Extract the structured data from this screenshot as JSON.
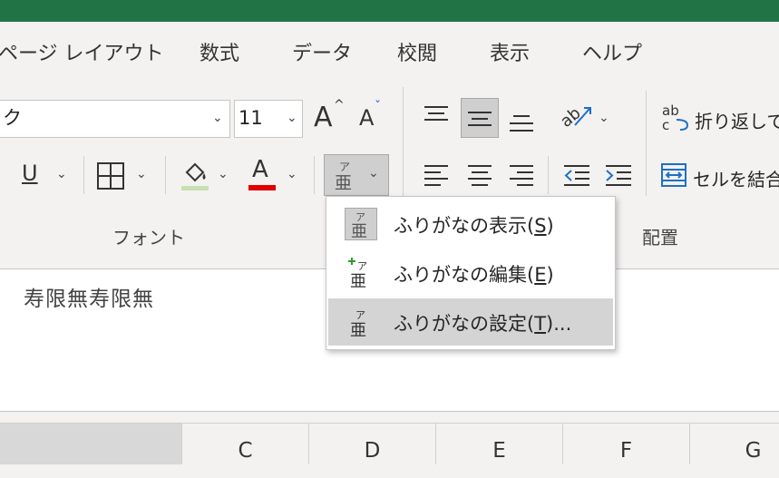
{
  "colors": {
    "title_bar": "#217346",
    "font_color_underline": "#e00000",
    "highlight_underline": "#c6e0b4",
    "hover_bg": "#d4d4d4"
  },
  "menu": {
    "tabs": [
      "ページ レイアウト",
      "数式",
      "データ",
      "校閲",
      "表示",
      "ヘルプ"
    ]
  },
  "font_group": {
    "font_name": "ク",
    "font_size": "11",
    "grow_icon_label": "A",
    "shrink_icon_label": "A",
    "underline_label": "U",
    "font_color_label": "A",
    "label": "フォント"
  },
  "alignment_group": {
    "wrap_text_label": "折り返して",
    "merge_label": "セルを結合",
    "label": "配置"
  },
  "phonetic_menu": {
    "items": [
      {
        "label": "ふりがなの表示(",
        "key": "S",
        "suffix": ")",
        "icon": "phonetic-show-icon"
      },
      {
        "label": "ふりがなの編集(",
        "key": "E",
        "suffix": ")",
        "icon": "phonetic-edit-icon"
      },
      {
        "label": "ふりがなの設定(",
        "key": "T",
        "suffix": ")...",
        "icon": "phonetic-settings-icon"
      }
    ]
  },
  "cell": {
    "text": "寿限無寿限無"
  },
  "columns": [
    "C",
    "D",
    "E",
    "F",
    "G"
  ]
}
